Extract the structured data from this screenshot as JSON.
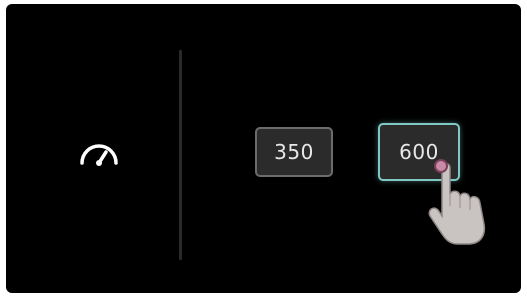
{
  "screen": {
    "icon": "speedometer-icon",
    "options": [
      {
        "label": "350",
        "selected": false
      },
      {
        "label": "600",
        "selected": true
      }
    ],
    "pointer": "hand-pointer-icon",
    "colors": {
      "background": "#000000",
      "button_fill": "#2b2b2b",
      "button_border": "#6c6c6c",
      "selected_border": "#7fc8c4",
      "text": "#e8e8e8",
      "touch_indicator": "#c88aa6"
    }
  }
}
